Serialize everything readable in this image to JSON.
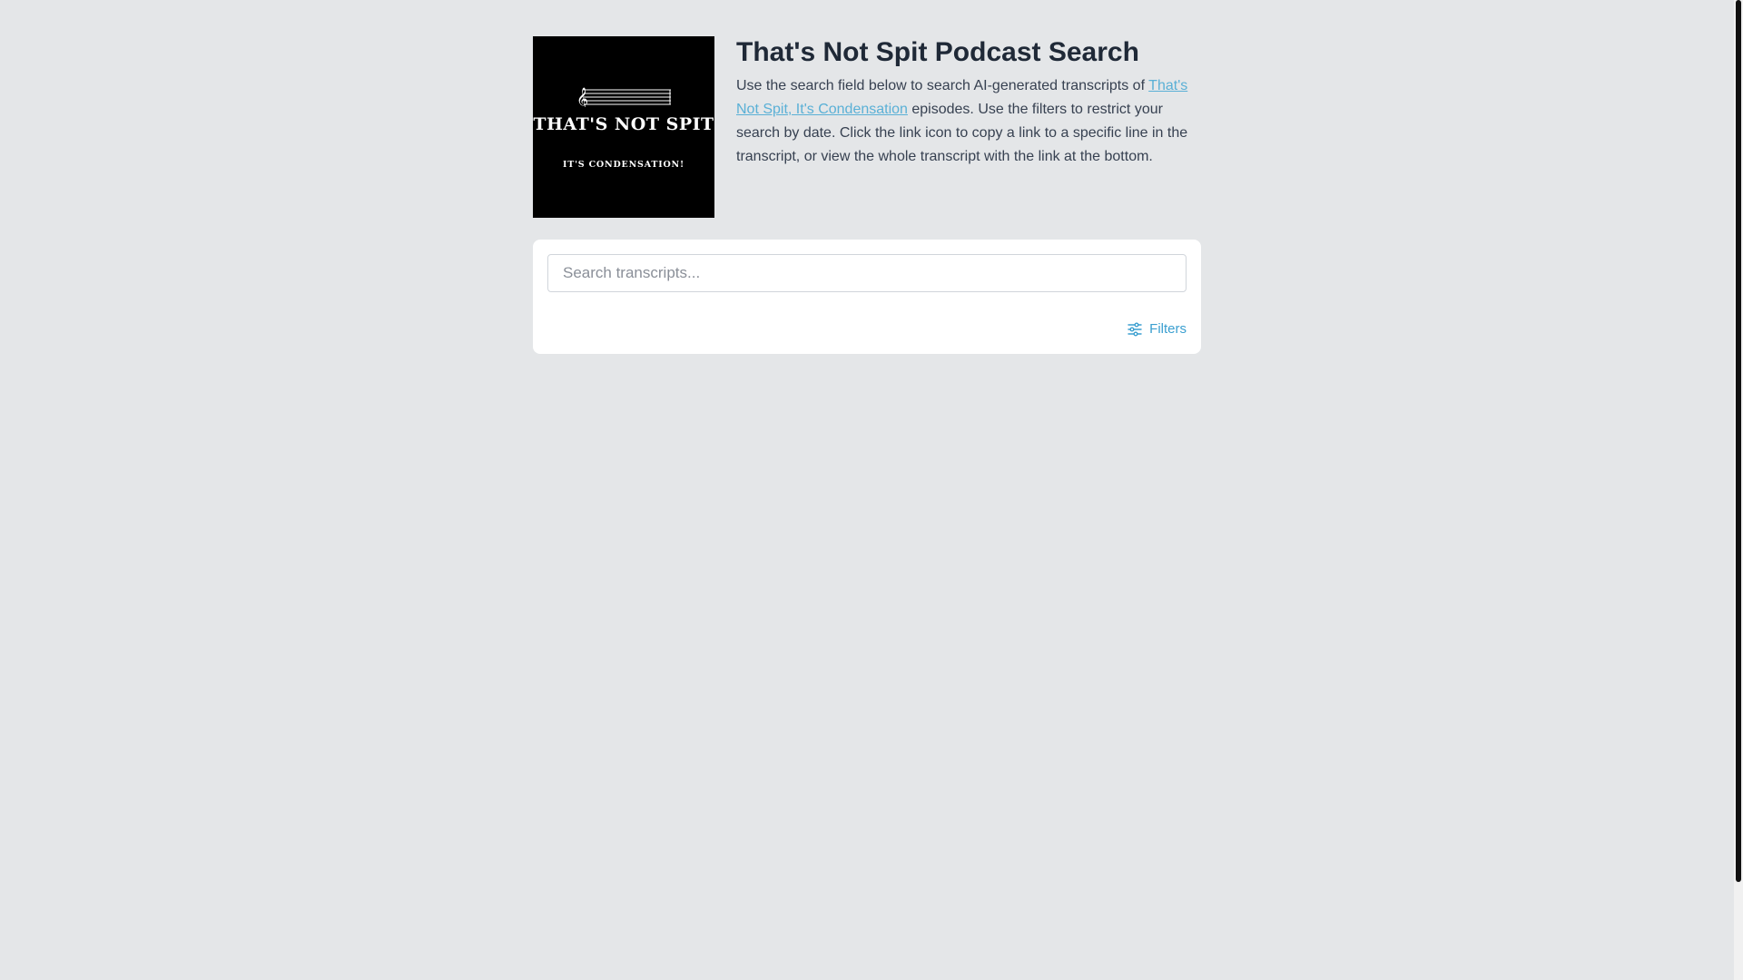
{
  "header": {
    "title": "That's Not Spit Podcast Search",
    "desc_before": "Use the search field below to search AI-generated transcripts of ",
    "desc_link": "That's Not Spit, It's Condensation",
    "desc_after": " episodes. Use the filters to restrict your search by date. Click the link icon to copy a link to a specific line in the transcript, or view the whole transcript with the link at the bottom."
  },
  "cover": {
    "line1": "THAT'S NOT SPIT",
    "line2": "IT'S CONDENSATION!"
  },
  "search": {
    "placeholder": "Search transcripts...",
    "filters_label": "Filters",
    "filters_icon": "sliders-icon"
  },
  "colors": {
    "background": "#e4e6e8",
    "accent": "#3b9fd0",
    "link": "#5ab0d6"
  }
}
